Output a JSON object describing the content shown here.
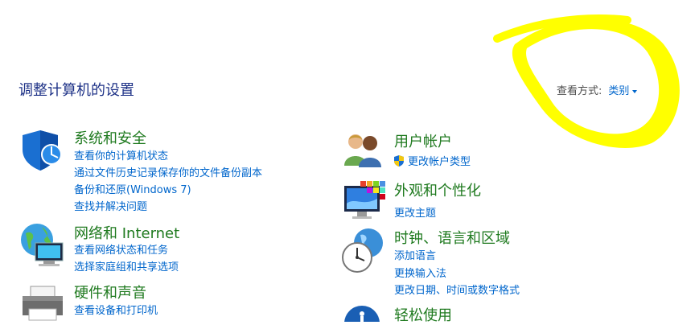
{
  "page": {
    "title": "调整计算机的设置",
    "view_by_label": "查看方式:",
    "view_by_value": "类别"
  },
  "colors": {
    "heading": "#1f7a1f",
    "link": "#0066cc",
    "title": "#1e3287",
    "annotation": "#ffff00"
  },
  "left_categories": [
    {
      "icon": "shield-icon",
      "title": "系统和安全",
      "links": [
        "查看你的计算机状态",
        "通过文件历史记录保存你的文件备份副本",
        "备份和还原(Windows 7)",
        "查找并解决问题"
      ]
    },
    {
      "icon": "network-globe-icon",
      "title": "网络和 Internet",
      "links": [
        "查看网络状态和任务",
        "选择家庭组和共享选项"
      ]
    },
    {
      "icon": "printer-icon",
      "title": "硬件和声音",
      "links": [
        "查看设备和打印机"
      ]
    }
  ],
  "right_categories": [
    {
      "icon": "users-icon",
      "title": "用户帐户",
      "links": [
        "更改帐户类型"
      ]
    },
    {
      "icon": "monitor-colors-icon",
      "title": "外观和个性化",
      "links": [
        "更改主题"
      ]
    },
    {
      "icon": "clock-globe-icon",
      "title": "时钟、语言和区域",
      "links": [
        "添加语言",
        "更换输入法",
        "更改日期、时间或数字格式"
      ]
    },
    {
      "icon": "ease-of-access-icon",
      "title": "轻松使用",
      "links": []
    }
  ]
}
